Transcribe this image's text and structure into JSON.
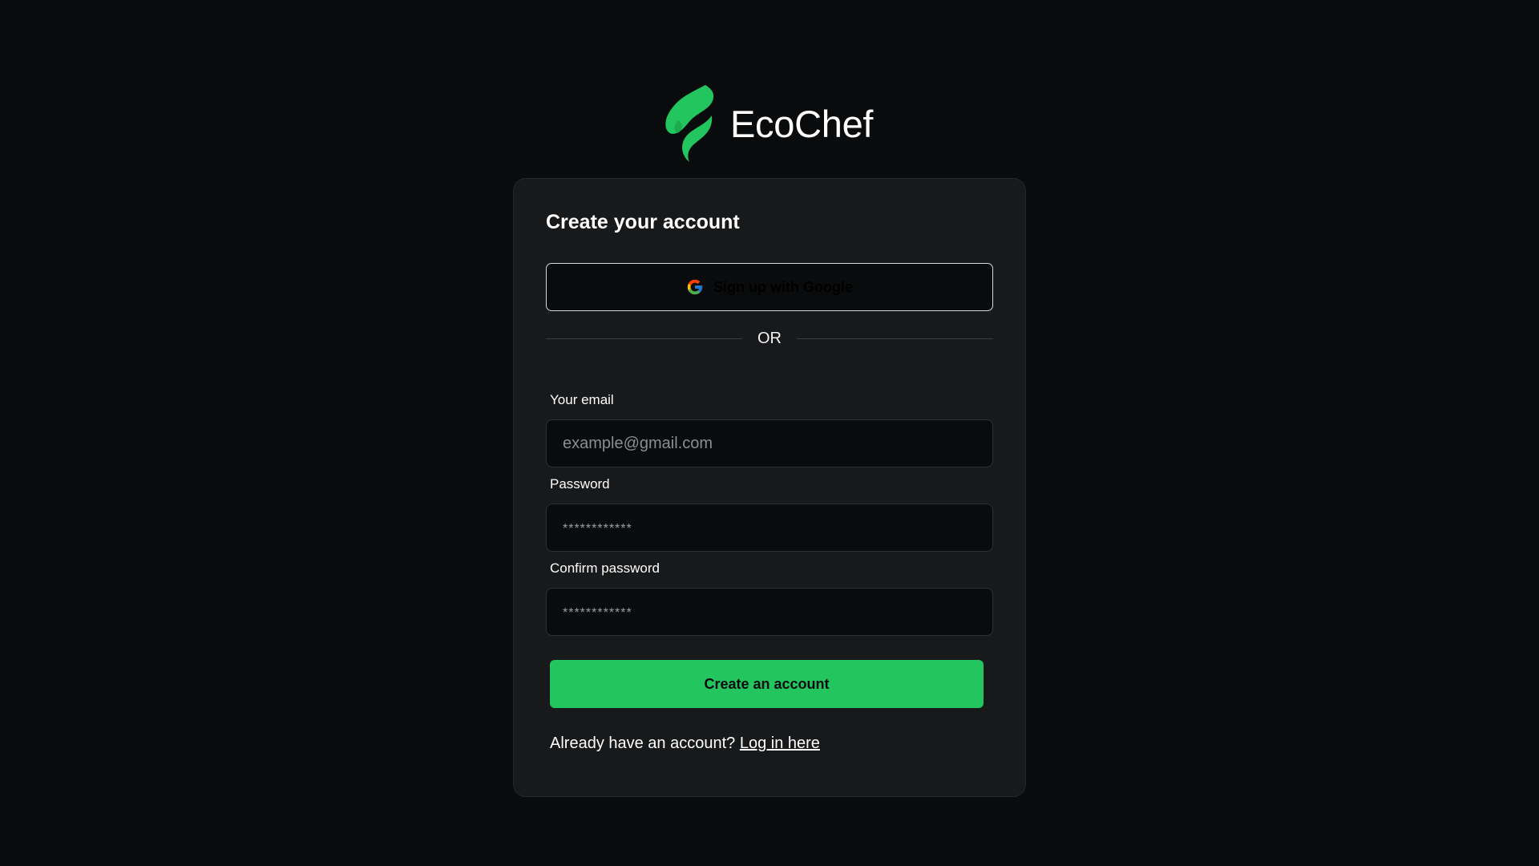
{
  "brand": {
    "name": "EcoChef",
    "accent_color": "#22c55e"
  },
  "signup": {
    "title": "Create your account",
    "google_button_label": "Sign up with Google",
    "divider_text": "OR",
    "email": {
      "label": "Your email",
      "placeholder": "example@gmail.com",
      "value": ""
    },
    "password": {
      "label": "Password",
      "placeholder": "************",
      "value": ""
    },
    "confirm_password": {
      "label": "Confirm password",
      "placeholder": "************",
      "value": ""
    },
    "submit_label": "Create an account",
    "login_prompt": "Already have an account?",
    "login_link": "Log in here"
  },
  "icons": {
    "logo": "leaf-flame-logo-icon",
    "google": "google-g-icon"
  }
}
